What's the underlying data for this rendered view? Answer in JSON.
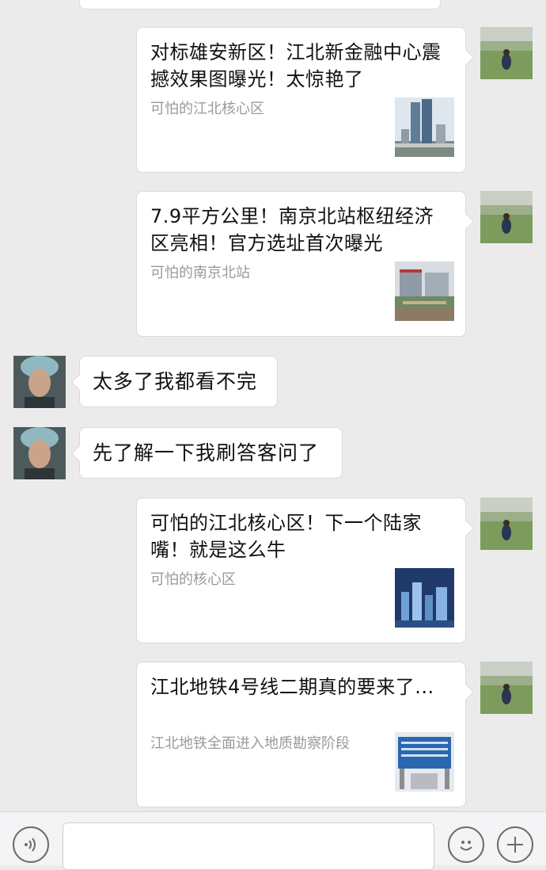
{
  "messages": [
    {
      "type": "link_card",
      "side": "right",
      "title": "对标雄安新区！江北新金融中心震撼效果图曝光！太惊艳了",
      "source": "可怕的江北核心区",
      "thumb_icon": "twin-towers-thumbnail"
    },
    {
      "type": "link_card",
      "side": "right",
      "title": "7.9平方公里！南京北站枢纽经济区亮相！官方选址首次曝光",
      "source": "可怕的南京北站",
      "thumb_icon": "station-rendering-thumbnail"
    },
    {
      "type": "text",
      "side": "left",
      "text": "太多了我都看不完"
    },
    {
      "type": "text",
      "side": "left",
      "text": "先了解一下我刷答客问了"
    },
    {
      "type": "link_card",
      "side": "right",
      "title": "可怕的江北核心区！下一个陆家嘴！就是这么牛",
      "source": "可怕的核心区",
      "thumb_icon": "city-aerial-thumbnail"
    },
    {
      "type": "link_card",
      "side": "right",
      "title": "江北地铁4号线二期真的要来了...",
      "source": "江北地铁全面进入地质勘察阶段",
      "thumb_icon": "construction-board-thumbnail"
    }
  ],
  "input_bar": {
    "voice_icon": "voice-icon",
    "emoji_icon": "emoji-icon",
    "plus_icon": "plus-icon",
    "placeholder": ""
  },
  "colors": {
    "background": "#ebebeb",
    "bubble": "#ffffff",
    "source_text": "#9a9a9a"
  }
}
